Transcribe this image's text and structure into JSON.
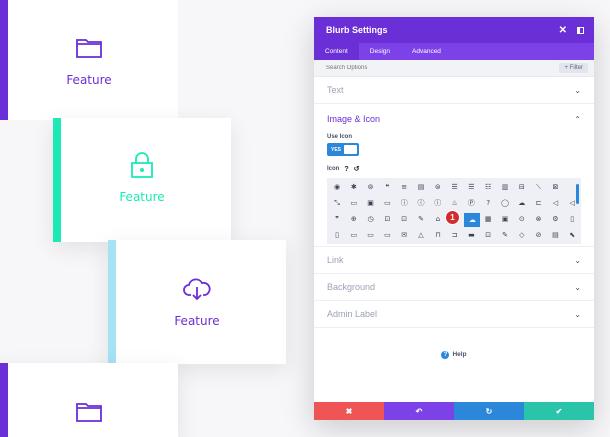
{
  "cards": [
    {
      "label": "Feature",
      "accent": "#6a2fd6",
      "icon": "folder-icon"
    },
    {
      "label": "Feature",
      "accent": "#1de9b6",
      "icon": "lock-icon"
    },
    {
      "label": "Feature",
      "accent": "#a6e2f4",
      "icon": "cloud-download-icon"
    },
    {
      "label": "",
      "accent": "#6a2fd6",
      "icon": "folder-icon"
    }
  ],
  "panel": {
    "title": "Blurb Settings",
    "close_glyph": "✕",
    "tabs": [
      "Content",
      "Design",
      "Advanced"
    ],
    "search_placeholder": "Search Options",
    "filter_label": "+ Filter",
    "sections": {
      "text": "Text",
      "image_icon": "Image & Icon",
      "link": "Link",
      "background": "Background",
      "admin_label": "Admin Label"
    },
    "use_icon_label": "Use Icon",
    "toggle_value": "YES",
    "icon_label": "Icon",
    "icon_help": "?",
    "icon_reset": "↺",
    "icon_rows": [
      [
        "◉",
        "✱",
        "⊚",
        "❝",
        "≡",
        "▤",
        "⊜",
        "☰",
        "☰",
        "☷",
        "▥",
        "⊟",
        "⟍",
        "⊠"
      ],
      [
        "⤡",
        "▭",
        "▣",
        "▭",
        "ⓘ",
        "ⓘ",
        "ⓘ",
        "♨",
        "Ⓟ",
        "?",
        "◯",
        "☁",
        "⊏",
        "◁",
        "◁"
      ],
      [
        "❞",
        "⊕",
        "◷",
        "⊡",
        "⊡",
        "✎",
        "⌂",
        "☁",
        "☁",
        "▦",
        "▣",
        "⊙",
        "⊗",
        "⚙",
        "▯"
      ],
      [
        "▯",
        "▭",
        "▭",
        "▭",
        "✉",
        "△",
        "⊓",
        "⊐",
        "▬",
        "⊡",
        "✎",
        "◇",
        "⊘",
        "▤",
        "⬉"
      ],
      [
        "△",
        "⊘",
        "⊛",
        "⊞",
        "◫",
        "⊜",
        "⊜",
        "▦",
        "▬",
        "▥",
        "▤",
        "⊡",
        "◯",
        "◍",
        "◔"
      ]
    ],
    "badge": "1",
    "help_label": "Help",
    "help_glyph": "?",
    "footer": [
      {
        "glyph": "✖",
        "color": "#ef5555",
        "name": "discard-button"
      },
      {
        "glyph": "↶",
        "color": "#7d41e8",
        "name": "undo-button"
      },
      {
        "glyph": "↻",
        "color": "#2b87da",
        "name": "redo-button"
      },
      {
        "glyph": "✔",
        "color": "#29c4a9",
        "name": "save-button"
      }
    ]
  }
}
